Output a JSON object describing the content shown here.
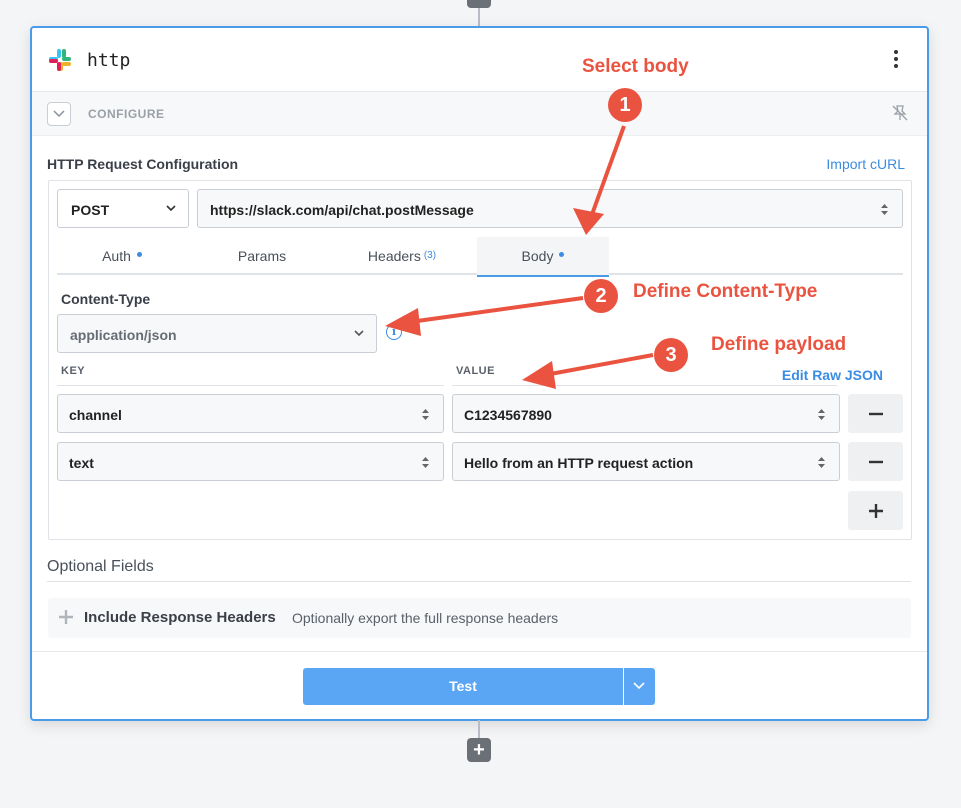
{
  "app": {
    "title": "http",
    "configure_label": "CONFIGURE"
  },
  "request": {
    "section_title": "HTTP Request Configuration",
    "import_link": "Import cURL",
    "method": "POST",
    "url": "https://slack.com/api/chat.postMessage"
  },
  "tabs": [
    {
      "label": "Auth",
      "dot": true
    },
    {
      "label": "Params"
    },
    {
      "label": "Headers",
      "count": "(3)"
    },
    {
      "label": "Body",
      "dot": true,
      "active": true
    }
  ],
  "body": {
    "content_type_label": "Content-Type",
    "content_type": "application/json",
    "key_header": "KEY",
    "value_header": "VALUE",
    "edit_raw_json": "Edit Raw JSON",
    "rows": [
      {
        "key": "channel",
        "value": "C1234567890"
      },
      {
        "key": "text",
        "value": "Hello from an HTTP request action"
      }
    ]
  },
  "optional": {
    "title": "Optional Fields",
    "item_name": "Include Response Headers",
    "item_desc": "Optionally export the full response headers"
  },
  "footer": {
    "test_label": "Test"
  },
  "annotations": [
    {
      "num": "1",
      "text": "Select body"
    },
    {
      "num": "2",
      "text": "Define Content-Type"
    },
    {
      "num": "3",
      "text": "Define payload"
    }
  ],
  "colors": {
    "accent": "#4a9be8",
    "annotation": "#e9533f",
    "test_button": "#5ba6f4"
  },
  "icons": {
    "logo": "slack-logo",
    "menu": "kebab-menu-icon",
    "collapse": "chevron-down-icon",
    "pin": "unpin-icon",
    "info": "info-icon",
    "add": "plus-icon",
    "remove": "minus-icon"
  }
}
